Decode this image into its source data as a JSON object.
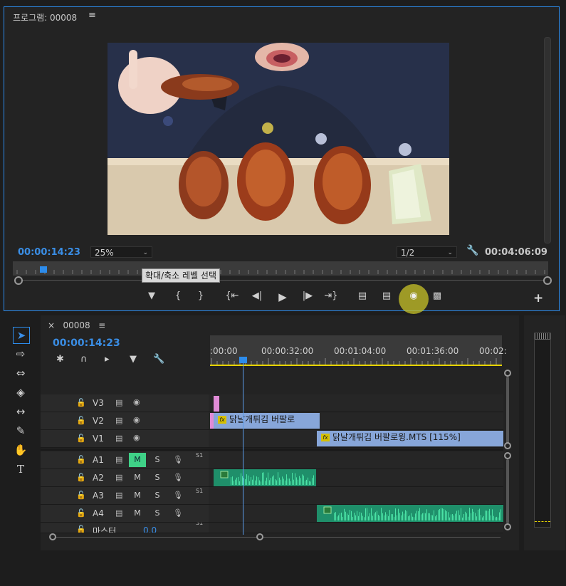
{
  "program": {
    "title": "프로그램: 00008",
    "menu_icon": "≡",
    "timecode_current": "00:00:14:23",
    "zoom": "25%",
    "resolution": "1/2",
    "timecode_duration": "00:04:06:09",
    "tooltip": "확대/축소 레벨 선택",
    "controls": [
      "marker",
      "mark-in",
      "mark-out",
      "go-to-in",
      "step-back",
      "play",
      "step-forward",
      "go-to-out",
      "lift",
      "extract",
      "export-frame",
      "compare"
    ]
  },
  "timeline": {
    "tab_close": "×",
    "sequence": "00008",
    "menu_icon": "≡",
    "timecode": "00:00:14:23",
    "ruler_labels": [
      ":00:00",
      "00:00:32:00",
      "00:01:04:00",
      "00:01:36:00",
      "00:02:"
    ],
    "tracks": {
      "v3": "V3",
      "v2": "V2",
      "v1": "V1",
      "a1": "A1",
      "a2": "A2",
      "a3": "A3",
      "a4": "A4",
      "master": "마스터",
      "master_value": "0.0",
      "m": "M",
      "s": "S",
      "audio_ch": "S1"
    },
    "clips": {
      "v2_clip": "닭날개튀김 버팔로",
      "v1_clip": "닭날개튀김 버팔로윙.MTS [115%]",
      "fx": "fx"
    }
  },
  "colors": {
    "accent": "#2d8ceb",
    "video_clip": "#87a6d9",
    "audio_clip": "#1f8f6a",
    "highlight": "#c8c328",
    "m_active": "#3fd187"
  }
}
